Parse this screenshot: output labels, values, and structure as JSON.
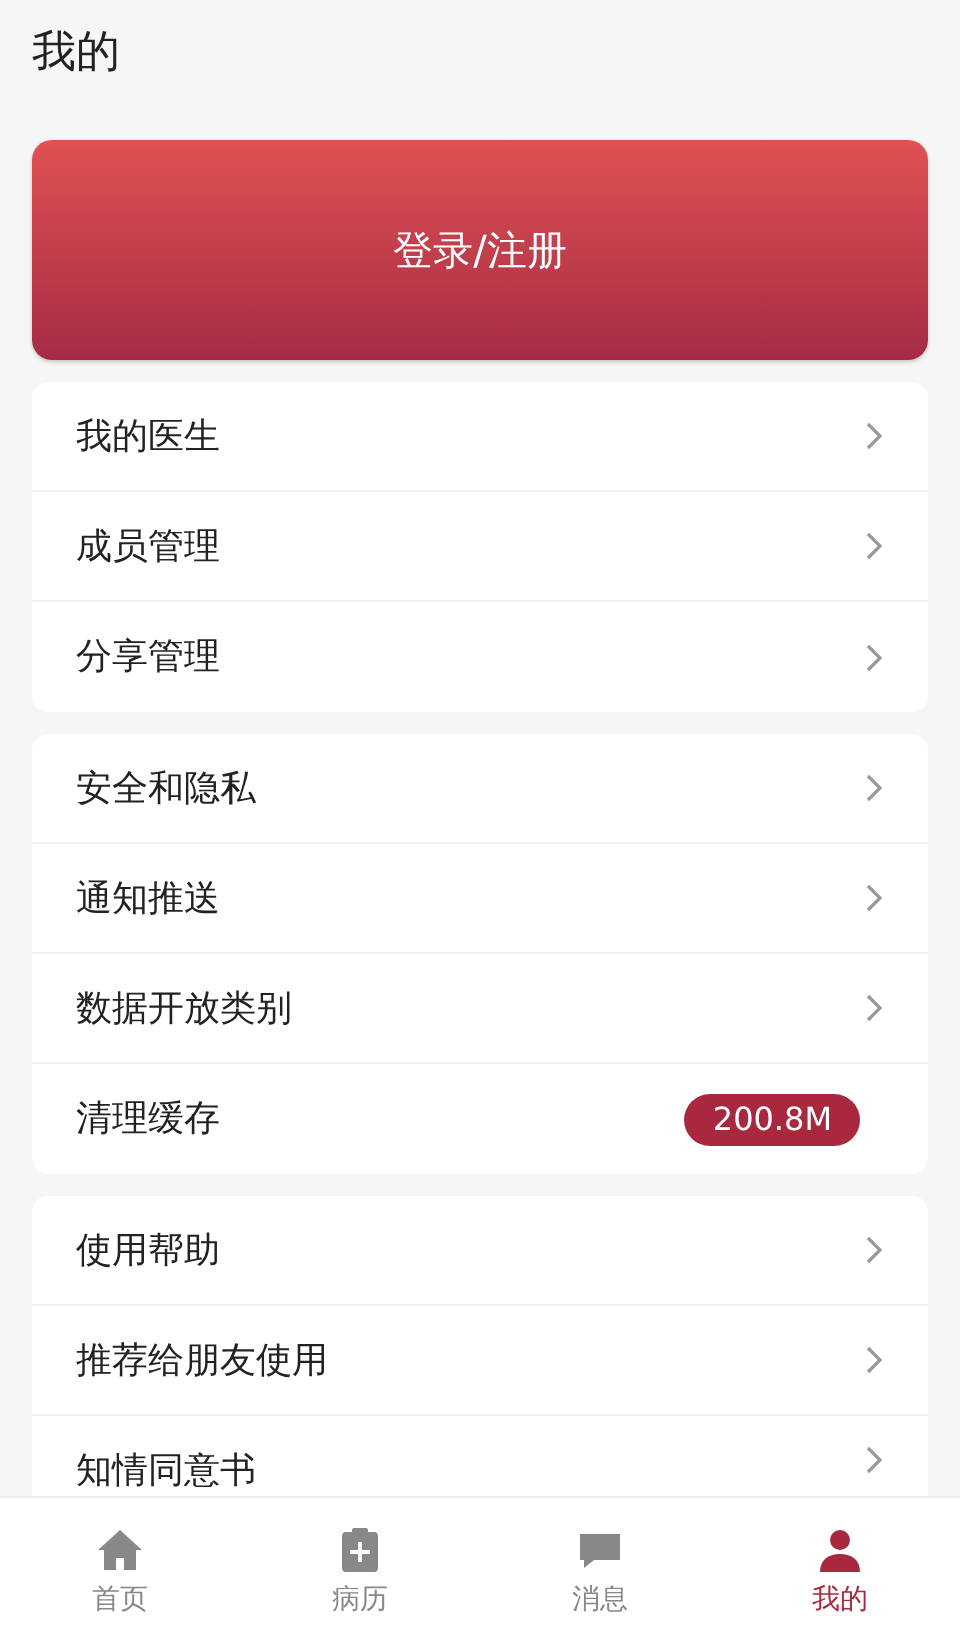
{
  "title": "我的",
  "login_button": "登录/注册",
  "groups": [
    {
      "items": [
        {
          "kind": "link",
          "label": "我的医生"
        },
        {
          "kind": "link",
          "label": "成员管理"
        },
        {
          "kind": "link",
          "label": "分享管理"
        }
      ]
    },
    {
      "items": [
        {
          "kind": "link",
          "label": "安全和隐私"
        },
        {
          "kind": "link",
          "label": "通知推送"
        },
        {
          "kind": "link",
          "label": "数据开放类别"
        },
        {
          "kind": "badge",
          "label": "清理缓存",
          "value": "200.8M"
        }
      ]
    },
    {
      "items": [
        {
          "kind": "link",
          "label": "使用帮助"
        },
        {
          "kind": "link",
          "label": "推荐给朋友使用"
        },
        {
          "kind": "link",
          "label": "知情同意书"
        }
      ]
    }
  ],
  "tab_bar": [
    {
      "kind": "home",
      "label": "首页",
      "selected": false
    },
    {
      "kind": "record",
      "label": "病历",
      "selected": false
    },
    {
      "kind": "message",
      "label": "消息",
      "selected": false
    },
    {
      "kind": "profile",
      "label": "我的",
      "selected": true
    }
  ]
}
